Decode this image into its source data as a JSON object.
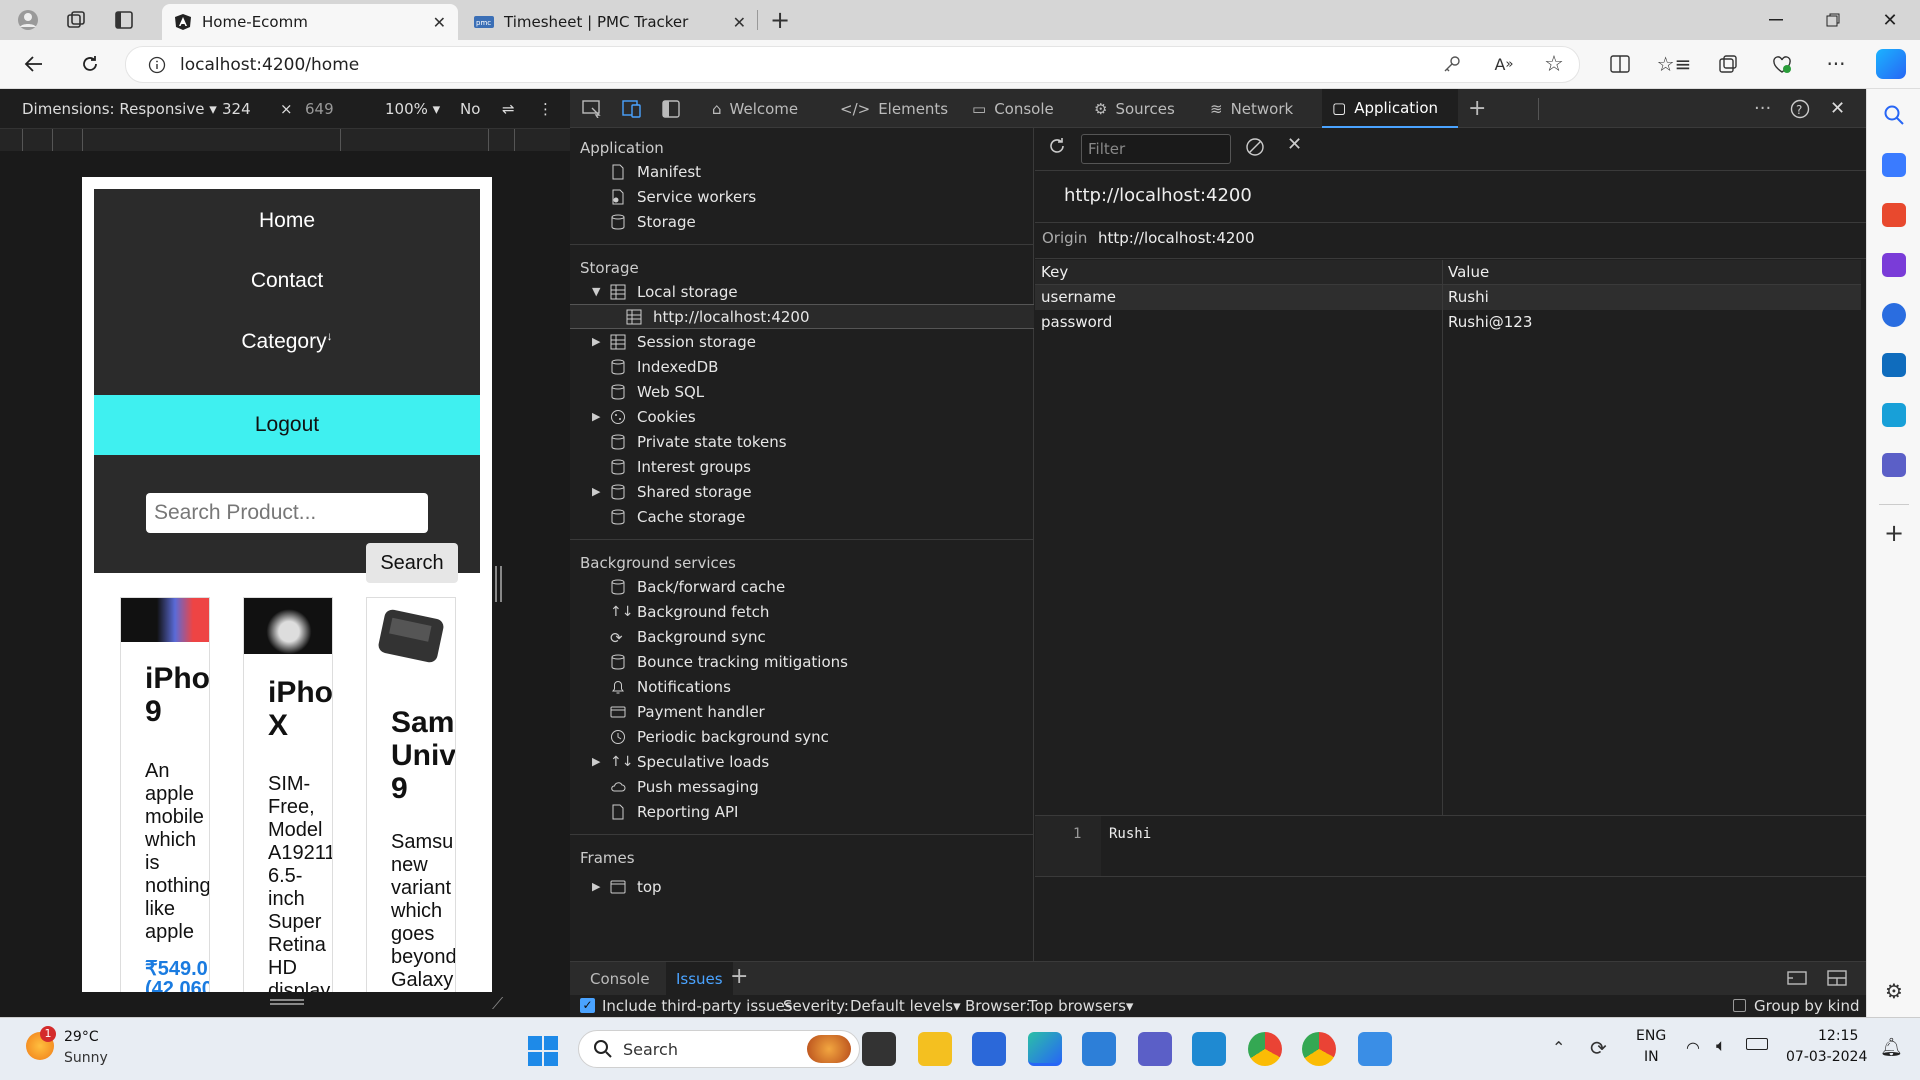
{
  "browser": {
    "tabs": [
      {
        "title": "Home-Ecomm",
        "active": true
      },
      {
        "title": "Timesheet | PMC Tracker",
        "active": false
      }
    ],
    "url": "localhost:4200/home"
  },
  "device_toolbar": {
    "dimensions_label": "Dimensions: Responsive",
    "width": "324",
    "times": "×",
    "height": "649",
    "zoom": "100%",
    "throttle": "No"
  },
  "site": {
    "nav": {
      "home": "Home",
      "contact": "Contact",
      "category": "Category",
      "logout": "Logout"
    },
    "search": {
      "placeholder": "Search Product...",
      "button": "Search"
    },
    "products": [
      {
        "title": "iPho\n9",
        "desc": "An\napple\nmobile\nwhich\nis\nnothing\nlike\napple",
        "price": "₹549.0",
        "price2": "(42,060"
      },
      {
        "title": "iPho\nX",
        "desc": "SIM-\nFree,\nModel\nA19211\n6.5-\ninch\nSuper\nRetina\nHD\ndisplay"
      },
      {
        "title": "Sam\nUniv\n9",
        "desc": "Samsu\nnew\nvariant\nwhich\ngoes\nbeyond\nGalaxy"
      }
    ]
  },
  "devtools": {
    "tabs": [
      "Welcome",
      "Elements",
      "Console",
      "Sources",
      "Network",
      "Application"
    ],
    "active_tab": "Application",
    "sections": {
      "application": {
        "title": "Application",
        "items": [
          "Manifest",
          "Service workers",
          "Storage"
        ]
      },
      "storage": {
        "title": "Storage",
        "items": [
          "Local storage",
          "http://localhost:4200",
          "Session storage",
          "IndexedDB",
          "Web SQL",
          "Cookies",
          "Private state tokens",
          "Interest groups",
          "Shared storage",
          "Cache storage"
        ]
      },
      "background": {
        "title": "Background services",
        "items": [
          "Back/forward cache",
          "Background fetch",
          "Background sync",
          "Bounce tracking mitigations",
          "Notifications",
          "Payment handler",
          "Periodic background sync",
          "Speculative loads",
          "Push messaging",
          "Reporting API"
        ]
      },
      "frames": {
        "title": "Frames",
        "items": [
          "top"
        ]
      }
    },
    "filter_placeholder": "Filter",
    "origin_header": "http://localhost:4200",
    "origin_label": "Origin",
    "origin_value": "http://localhost:4200",
    "table": {
      "headers": [
        "Key",
        "Value"
      ],
      "rows": [
        {
          "key": "username",
          "value": "Rushi"
        },
        {
          "key": "password",
          "value": "Rushi@123"
        }
      ]
    },
    "preview": {
      "line_no": "1",
      "text": "Rushi"
    },
    "drawer": {
      "tabs": [
        "Console",
        "Issues"
      ],
      "active_tab": "Issues",
      "third_party_label": "Include third-party issues",
      "severity_label": "Severity:",
      "severity_value": "Default levels",
      "browser_label": "Browser:",
      "browser_value": "Top browsers",
      "group_label": "Group by kind"
    }
  },
  "taskbar": {
    "weather_temp": "29°C",
    "weather_desc": "Sunny",
    "weather_badge": "1",
    "search": "Search",
    "lang": "ENG",
    "region": "IN",
    "time": "12:15",
    "date": "07-03-2024"
  },
  "colors": {
    "accent": "#3ff0f0",
    "devtools_bg": "#1f1f1f",
    "link": "#4aa3ff"
  }
}
